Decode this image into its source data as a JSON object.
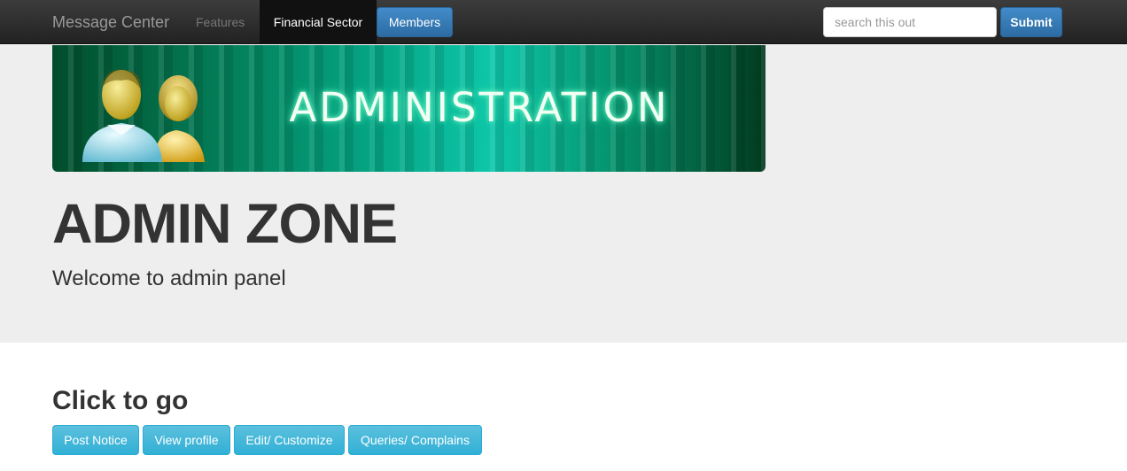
{
  "navbar": {
    "brand": "Message Center",
    "links": [
      {
        "label": "Features"
      },
      {
        "label": "Financial Sector"
      },
      {
        "label": "Members"
      }
    ],
    "search": {
      "placeholder": "search this out",
      "value": ""
    },
    "submit_label": "Submit"
  },
  "banner": {
    "text": "ADMINISTRATION",
    "icon": "users-icon"
  },
  "jumbotron": {
    "title": "ADMIN ZONE",
    "subtitle": "Welcome to admin panel"
  },
  "actions": {
    "heading": "Click to go",
    "buttons": [
      {
        "label": "Post Notice"
      },
      {
        "label": "View profile"
      },
      {
        "label": "Edit/ Customize"
      },
      {
        "label": "Queries/ Complains"
      }
    ]
  },
  "colors": {
    "primary": "#428bca",
    "info": "#5bc0de",
    "navbar": "#222222",
    "jumbotron": "#eeeeee"
  }
}
